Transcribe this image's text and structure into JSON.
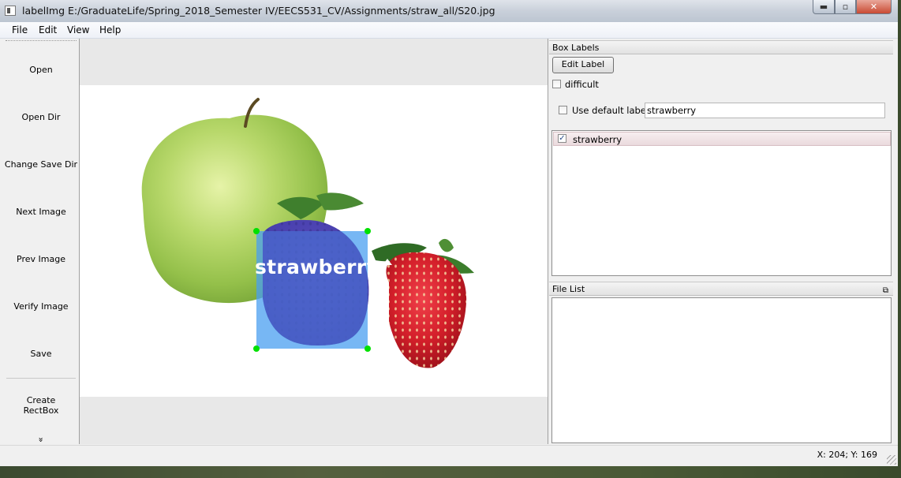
{
  "window": {
    "title": "labelImg E:/GraduateLife/Spring_2018_Semester IV/EECS531_CV/Assignments/straw_all/S20.jpg",
    "minimize_glyph": "▬",
    "maximize_glyph": "▫",
    "close_glyph": "✕"
  },
  "menu": [
    "File",
    "Edit",
    "View",
    "Help"
  ],
  "toolbar": {
    "buttons": [
      "Open",
      "Open Dir",
      "Change Save Dir",
      "Next Image",
      "Prev Image",
      "Verify Image",
      "Save"
    ],
    "create_label_line1": "Create",
    "create_label_line2": "RectBox",
    "expand_glyph": "»"
  },
  "canvas": {
    "box_label": "strawberry",
    "box_fill_color": "#4a9ff0",
    "handle_color": "#00e000"
  },
  "box_labels_panel": {
    "title": "Box Labels",
    "edit_label_button": "Edit Label",
    "difficult_label": "difficult",
    "use_default_label": "Use default label",
    "default_label_value": "strawberry",
    "labels": [
      {
        "text": "strawberry",
        "checked": true
      }
    ]
  },
  "file_list_panel": {
    "title": "File List",
    "float_icon": "float-icon",
    "float_glyph": "⧉"
  },
  "status": {
    "coords": "X: 204; Y: 169"
  }
}
